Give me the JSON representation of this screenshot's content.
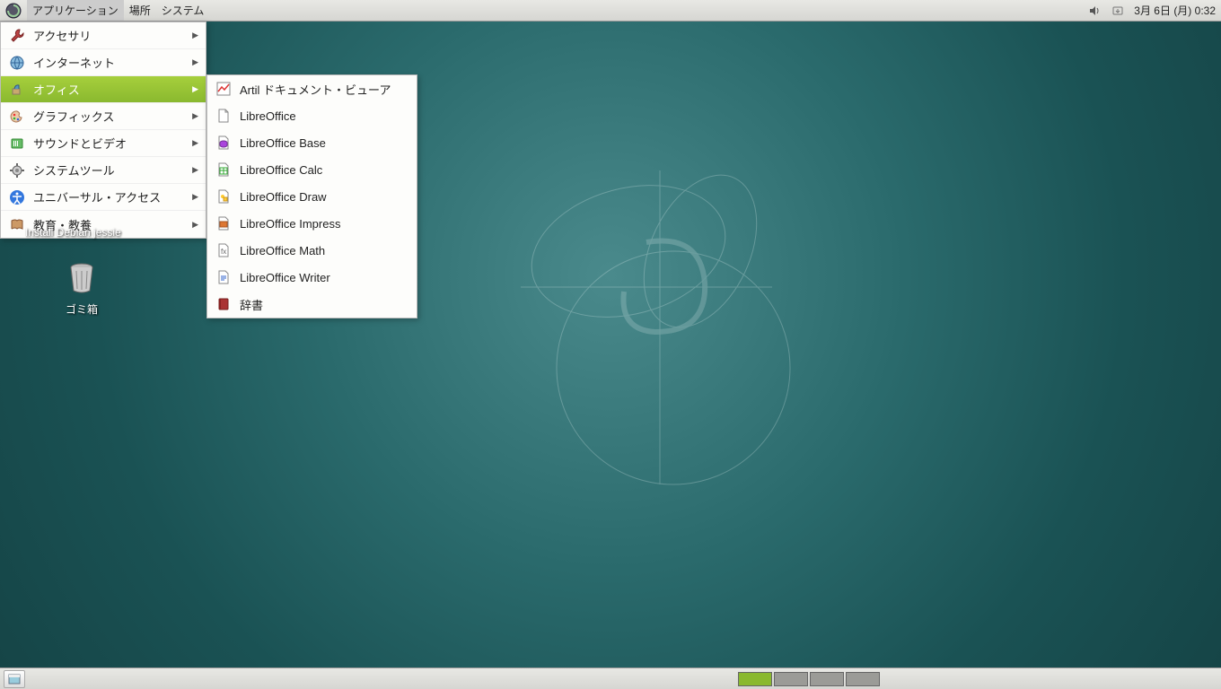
{
  "panel": {
    "menus": {
      "applications": "アプリケーション",
      "places": "場所",
      "system": "システム"
    },
    "clock": "3月 6日 (月)  0:32"
  },
  "desktop": {
    "install_label": "Install Debian jessie",
    "trash_label": "ゴミ箱"
  },
  "app_menu": {
    "items": [
      {
        "label": "アクセサリ",
        "icon": "wrench"
      },
      {
        "label": "インターネット",
        "icon": "globe"
      },
      {
        "label": "オフィス",
        "icon": "office",
        "highlight": true
      },
      {
        "label": "グラフィックス",
        "icon": "palette"
      },
      {
        "label": "サウンドとビデオ",
        "icon": "media"
      },
      {
        "label": "システムツール",
        "icon": "gear"
      },
      {
        "label": "ユニバーサル・アクセス",
        "icon": "access"
      },
      {
        "label": "教育・教養",
        "icon": "education"
      }
    ]
  },
  "office_submenu": {
    "items": [
      {
        "label": "Artil ドキュメント・ビューア",
        "icon": "chart"
      },
      {
        "label": "LibreOffice",
        "icon": "doc-blank"
      },
      {
        "label": "LibreOffice Base",
        "icon": "base"
      },
      {
        "label": "LibreOffice Calc",
        "icon": "calc"
      },
      {
        "label": "LibreOffice Draw",
        "icon": "draw"
      },
      {
        "label": "LibreOffice Impress",
        "icon": "impress"
      },
      {
        "label": "LibreOffice Math",
        "icon": "math"
      },
      {
        "label": "LibreOffice Writer",
        "icon": "writer"
      },
      {
        "label": "辞書",
        "icon": "dict"
      }
    ]
  }
}
